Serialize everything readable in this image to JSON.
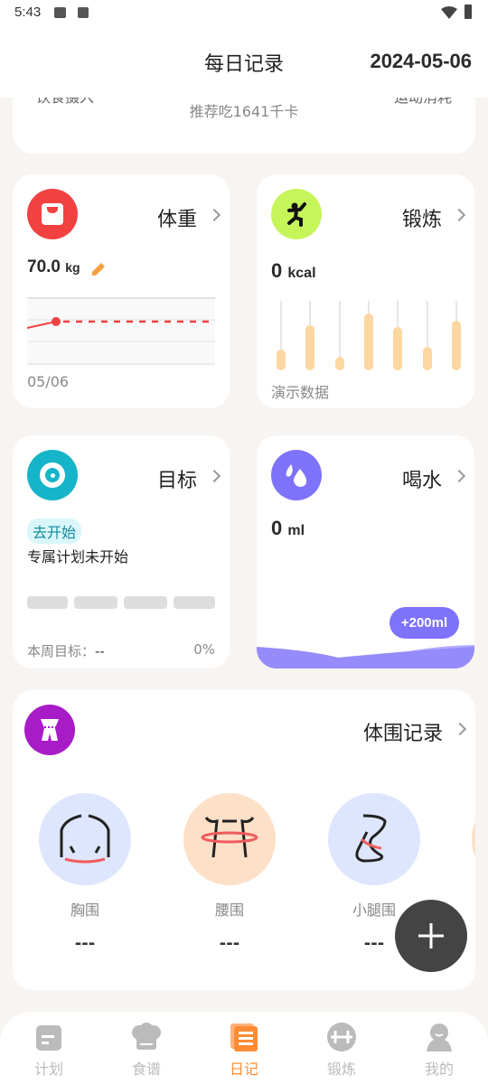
{
  "status_bar": {
    "time": "5:43"
  },
  "header": {
    "title": "每日记录",
    "date": "2024-05-06"
  },
  "summary_card": {
    "left_label": "饮食摄入",
    "center_text": "推荐吃1641千卡",
    "right_label": "运动消耗"
  },
  "weight": {
    "title": "体重",
    "value": "70.0",
    "unit": "kg",
    "date_label": "05/06",
    "accent": "#f24141",
    "icon": "scale-icon"
  },
  "exercise": {
    "title": "锻炼",
    "value": "0",
    "unit": "kcal",
    "note": "演示数据",
    "accent": "#c6f55a",
    "icon": "running-person-icon",
    "bar_fractions": [
      0.3,
      0.65,
      0.2,
      0.82,
      0.62,
      0.34,
      0.72
    ]
  },
  "goal": {
    "title": "目标",
    "badge": "去开始",
    "description": "专属计划未开始",
    "weekly_label": "本周目标：",
    "weekly_value": "--",
    "percent": "0%",
    "accent": "#16b4c8",
    "icon": "target-icon",
    "segments": 4
  },
  "water": {
    "title": "喝水",
    "value": "0",
    "unit": "ml",
    "add_button": "+200ml",
    "accent": "#7f72fb",
    "icon": "water-drops-icon"
  },
  "body_measure": {
    "title": "体围记录",
    "accent": "#a81cc7",
    "icon": "body-measure-icon",
    "items": [
      {
        "label": "胸围",
        "value": "---",
        "bg": "#dde6fd"
      },
      {
        "label": "腰围",
        "value": "---",
        "bg": "#fde0c8"
      },
      {
        "label": "小腿围",
        "value": "---",
        "bg": "#dde6fd"
      }
    ]
  },
  "nav": {
    "active": "日记",
    "items": [
      {
        "label": "计划",
        "icon": "calendar-icon"
      },
      {
        "label": "食谱",
        "icon": "chef-hat-icon"
      },
      {
        "label": "日记",
        "icon": "diary-icon"
      },
      {
        "label": "锻炼",
        "icon": "dumbbell-icon"
      },
      {
        "label": "我的",
        "icon": "profile-icon"
      }
    ]
  }
}
